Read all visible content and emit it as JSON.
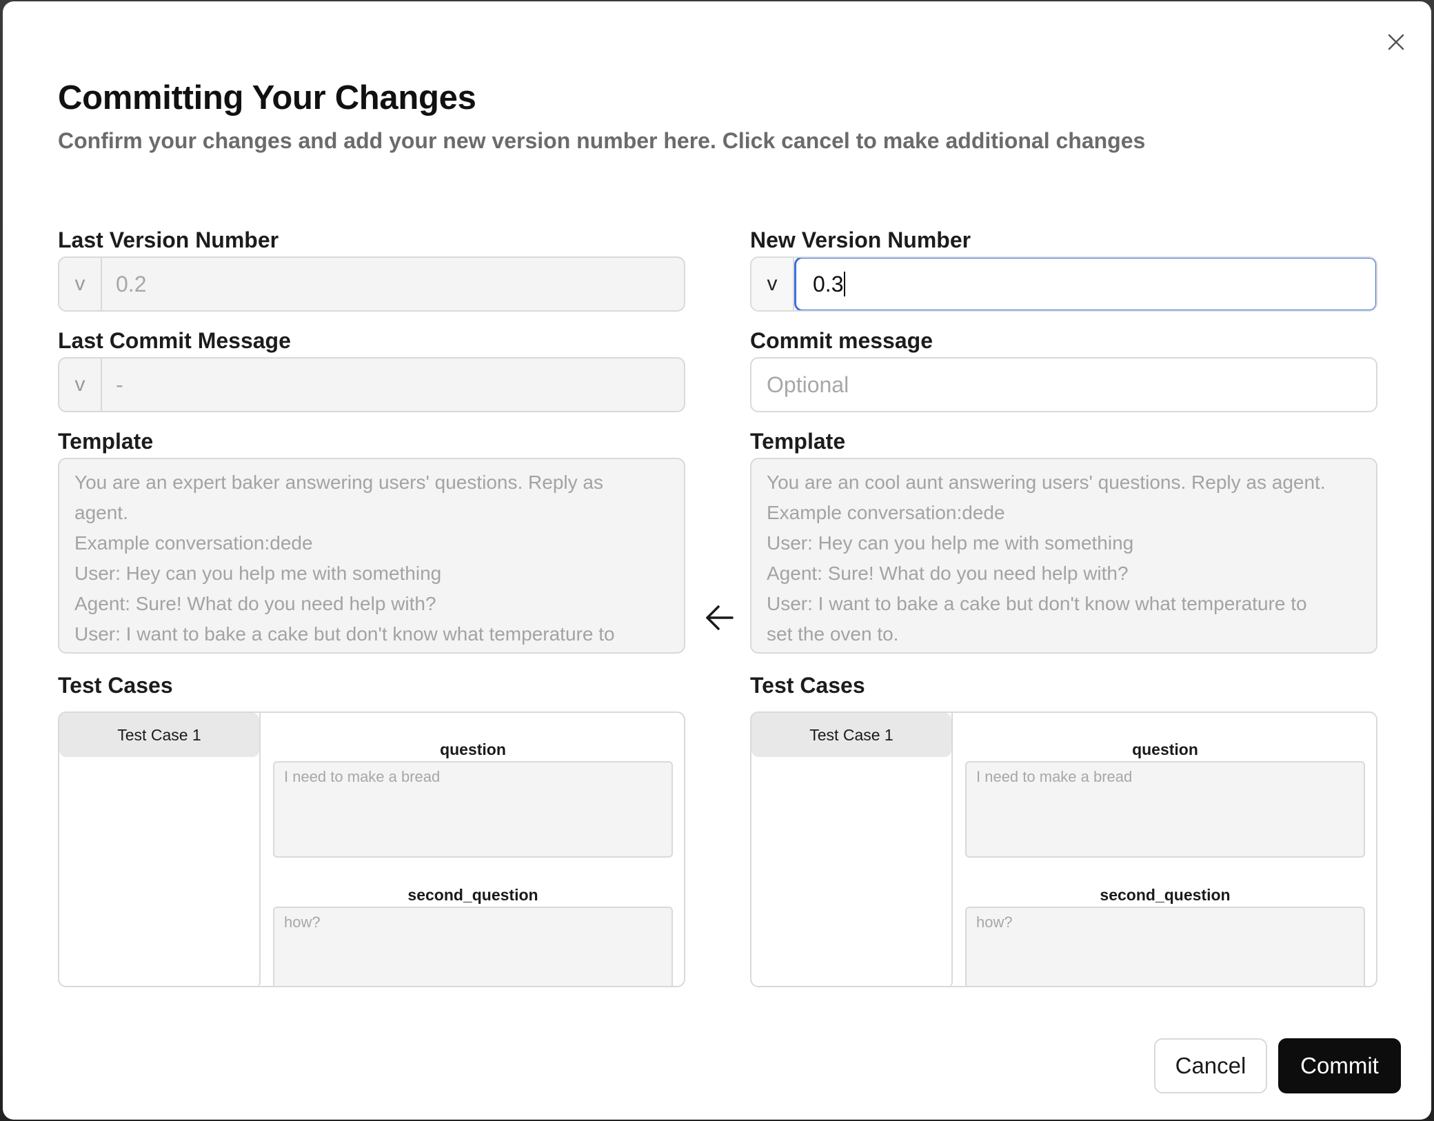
{
  "dialog": {
    "title": "Committing Your Changes",
    "subtitle": "Confirm your changes and add your new version number here. Click cancel to make additional changes"
  },
  "left": {
    "version_label": "Last Version Number",
    "version_prefix": "v",
    "version_value": "0.2",
    "commit_label": "Last Commit Message",
    "commit_prefix": "v",
    "commit_value": "-",
    "template_label": "Template",
    "template_lines": [
      "You are an expert baker answering users' questions. Reply as",
      "agent.",
      "Example conversation:dede",
      "User: Hey can you help me with something",
      "Agent: Sure! What do you need help with?",
      "User: I want to bake a cake but don't know what temperature to"
    ],
    "test_cases_label": "Test Cases",
    "test_case_tab": "Test Case 1",
    "fields": [
      {
        "name": "question",
        "value": "I need to make a bread"
      },
      {
        "name": "second_question",
        "value": "how?"
      }
    ]
  },
  "right": {
    "version_label": "New Version Number",
    "version_prefix": "v",
    "version_value": "0.3",
    "commit_label": "Commit message",
    "commit_placeholder": "Optional",
    "template_label": "Template",
    "template_lines": [
      "You are an cool aunt answering users' questions. Reply as agent.",
      "Example conversation:dede",
      "User: Hey can you help me with something",
      "Agent: Sure! What do you need help with?",
      "User: I want to bake a cake but don't know what temperature to",
      "set the oven to."
    ],
    "test_cases_label": "Test Cases",
    "test_case_tab": "Test Case 1",
    "fields": [
      {
        "name": "question",
        "value": "I need to make a bread"
      },
      {
        "name": "second_question",
        "value": "how?"
      }
    ]
  },
  "icons": {
    "close": "close-icon",
    "arrow": "arrow-left-icon"
  },
  "buttons": {
    "cancel": "Cancel",
    "commit": "Commit"
  }
}
